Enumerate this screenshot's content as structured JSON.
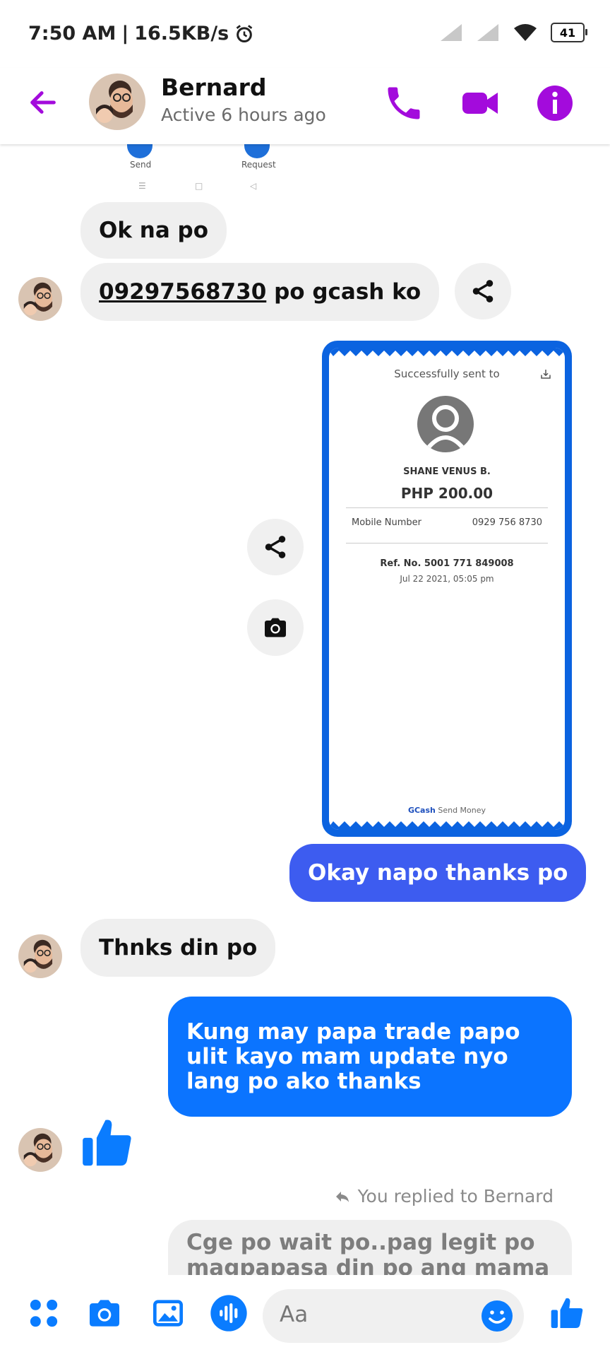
{
  "status_bar": {
    "time": "7:50 AM",
    "net_speed": "16.5KB/s",
    "battery": "41"
  },
  "header": {
    "name": "Bernard",
    "status": "Active 6 hours ago"
  },
  "remnant": {
    "send_label": "Send",
    "request_label": "Request"
  },
  "messages": {
    "m1": "Ok na po",
    "m2_number": "09297568730",
    "m2_rest": " po gcash ko",
    "m3": "Okay napo thanks po",
    "m4": "Thnks din po",
    "m5": "Kung may papa trade papo ulit kayo mam update nyo lang po ako thanks",
    "reply_label": "You replied to Bernard",
    "reply_text": "Cge po wait po..pag legit po magpapasa din po ang mama at"
  },
  "receipt": {
    "title": "Successfully sent to",
    "recipient": "SHANE VENUS B.",
    "amount": "PHP 200.00",
    "mobile_label": "Mobile Number",
    "mobile_value": "0929 756 8730",
    "ref": "Ref. No. 5001 771 849008",
    "date": "Jul 22 2021, 05:05 pm",
    "footer_brand": "GCash",
    "footer_text": " Send Money"
  },
  "composer": {
    "placeholder": "Aa"
  },
  "colors": {
    "accent": "#a30bdc",
    "blue": "#0a7cff",
    "bubble_in": "#efefef"
  }
}
